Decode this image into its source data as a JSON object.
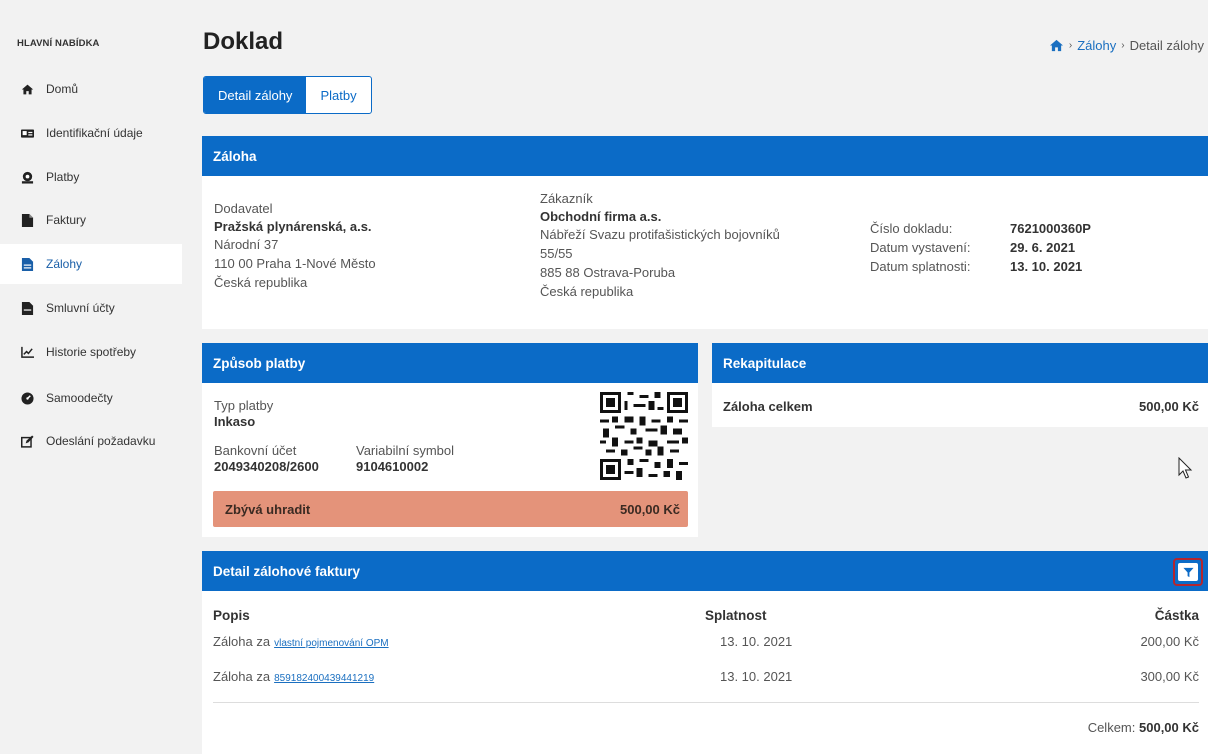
{
  "sidebar": {
    "heading": "HLAVNÍ NABÍDKA",
    "items": [
      {
        "label": "Domů",
        "icon": "home-icon"
      },
      {
        "label": "Identifikační údaje",
        "icon": "id-card-icon"
      },
      {
        "label": "Platby",
        "icon": "money-icon"
      },
      {
        "label": "Faktury",
        "icon": "invoice-icon"
      },
      {
        "label": "Zálohy",
        "icon": "document-icon"
      },
      {
        "label": "Smluvní účty",
        "icon": "contract-icon"
      },
      {
        "label": "Historie spotřeby",
        "icon": "chart-icon"
      },
      {
        "label": "Samoodečty",
        "icon": "meter-icon"
      },
      {
        "label": "Odeslání požadavku",
        "icon": "edit-icon"
      }
    ],
    "active_index": 4
  },
  "header": {
    "title": "Doklad",
    "breadcrumb": {
      "link": "Zálohy",
      "current": "Detail zálohy"
    }
  },
  "tabs": [
    {
      "label": "Detail zálohy",
      "active": true
    },
    {
      "label": "Platby",
      "active": false
    }
  ],
  "zaloha": {
    "title": "Záloha",
    "supplier": {
      "label": "Dodavatel",
      "name": "Pražská plynárenská, a.s.",
      "street": "Národní 37",
      "city": "110 00 Praha 1-Nové Město",
      "country": "Česká republika"
    },
    "customer": {
      "label": "Zákazník",
      "name": "Obchodní firma a.s.",
      "street": "Nábřeží Svazu protifašistických bojovníků",
      "street2": "55/55",
      "city": "885 88 Ostrava-Poruba",
      "country": "Česká republika"
    },
    "doc": {
      "number_label": "Číslo dokladu:",
      "number": "7621000360P",
      "issued_label": "Datum vystavení:",
      "issued": "29. 6. 2021",
      "due_label": "Datum splatnosti:",
      "due": "13. 10. 2021"
    }
  },
  "payment": {
    "title": "Způsob platby",
    "type_label": "Typ platby",
    "type": "Inkaso",
    "account_label": "Bankovní účet",
    "account": "2049340208/2600",
    "vs_label": "Variabilní symbol",
    "vs": "9104610002",
    "remaining_label": "Zbývá uhradit",
    "remaining": "500,00 Kč"
  },
  "recap": {
    "title": "Rekapitulace",
    "total_label": "Záloha celkem",
    "total": "500,00 Kč"
  },
  "detail": {
    "title": "Detail zálohové faktury",
    "columns": [
      "Popis",
      "Splatnost",
      "Částka"
    ],
    "rows": [
      {
        "prefix": "Záloha za",
        "link": "vlastní pojmenování OPM",
        "due": "13. 10. 2021",
        "amount": "200,00 Kč"
      },
      {
        "prefix": "Záloha za",
        "link": "859182400439441219",
        "due": "13. 10. 2021",
        "amount": "300,00 Kč"
      }
    ],
    "total_label": "Celkem:",
    "total": "500,00 Kč"
  },
  "colors": {
    "primary": "#0b6bc7",
    "remaining_bg": "#e4937a",
    "filter_border": "#b3262f"
  }
}
